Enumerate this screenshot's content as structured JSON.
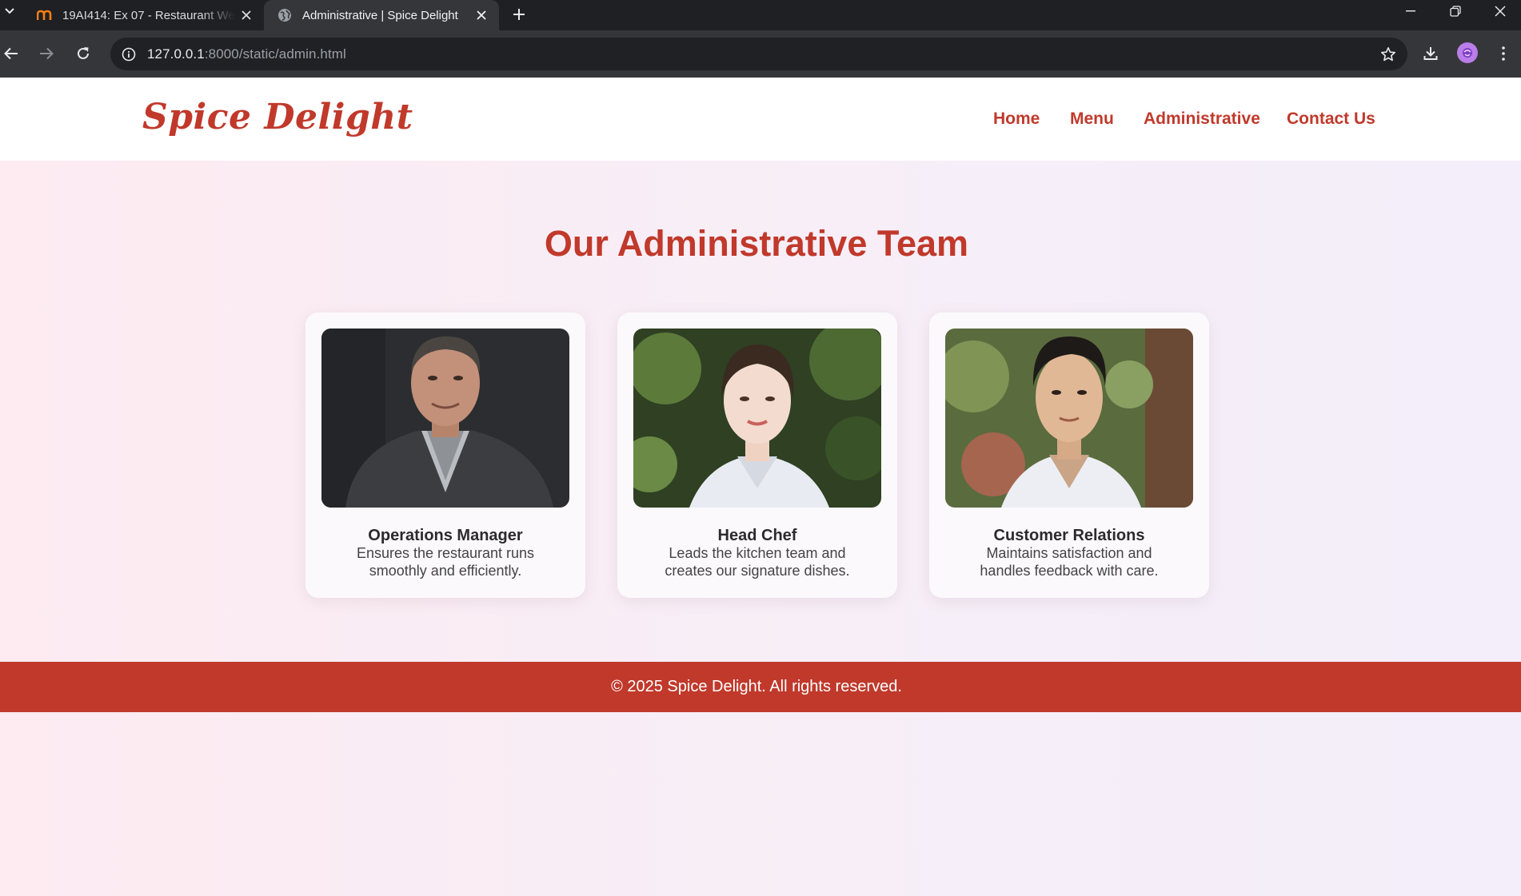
{
  "browser": {
    "tabs": [
      {
        "title": "19AI414: Ex 07 - Restaurant We",
        "favicon": "moodle-icon",
        "active": false
      },
      {
        "title": "Administrative | Spice Delight",
        "favicon": "globe-icon",
        "active": true
      }
    ],
    "address": {
      "host": "127.0.0.1",
      "path": ":8000/static/admin.html"
    }
  },
  "site": {
    "logo": "Spice Delight",
    "nav": [
      "Home",
      "Menu",
      "Administrative",
      "Contact Us"
    ],
    "heading": "Our Administrative Team",
    "team": [
      {
        "role": "Operations Manager",
        "description": "Ensures the restaurant runs smoothly and efficiently."
      },
      {
        "role": "Head Chef",
        "description": "Leads the kitchen team and creates our signature dishes."
      },
      {
        "role": "Customer Relations",
        "description": "Maintains satisfaction and handles feedback with care."
      }
    ],
    "footer": "© 2025 Spice Delight. All rights reserved."
  },
  "colors": {
    "brand": "#c0392b",
    "tabbar": "#1f2023",
    "toolbar": "#35363a"
  }
}
